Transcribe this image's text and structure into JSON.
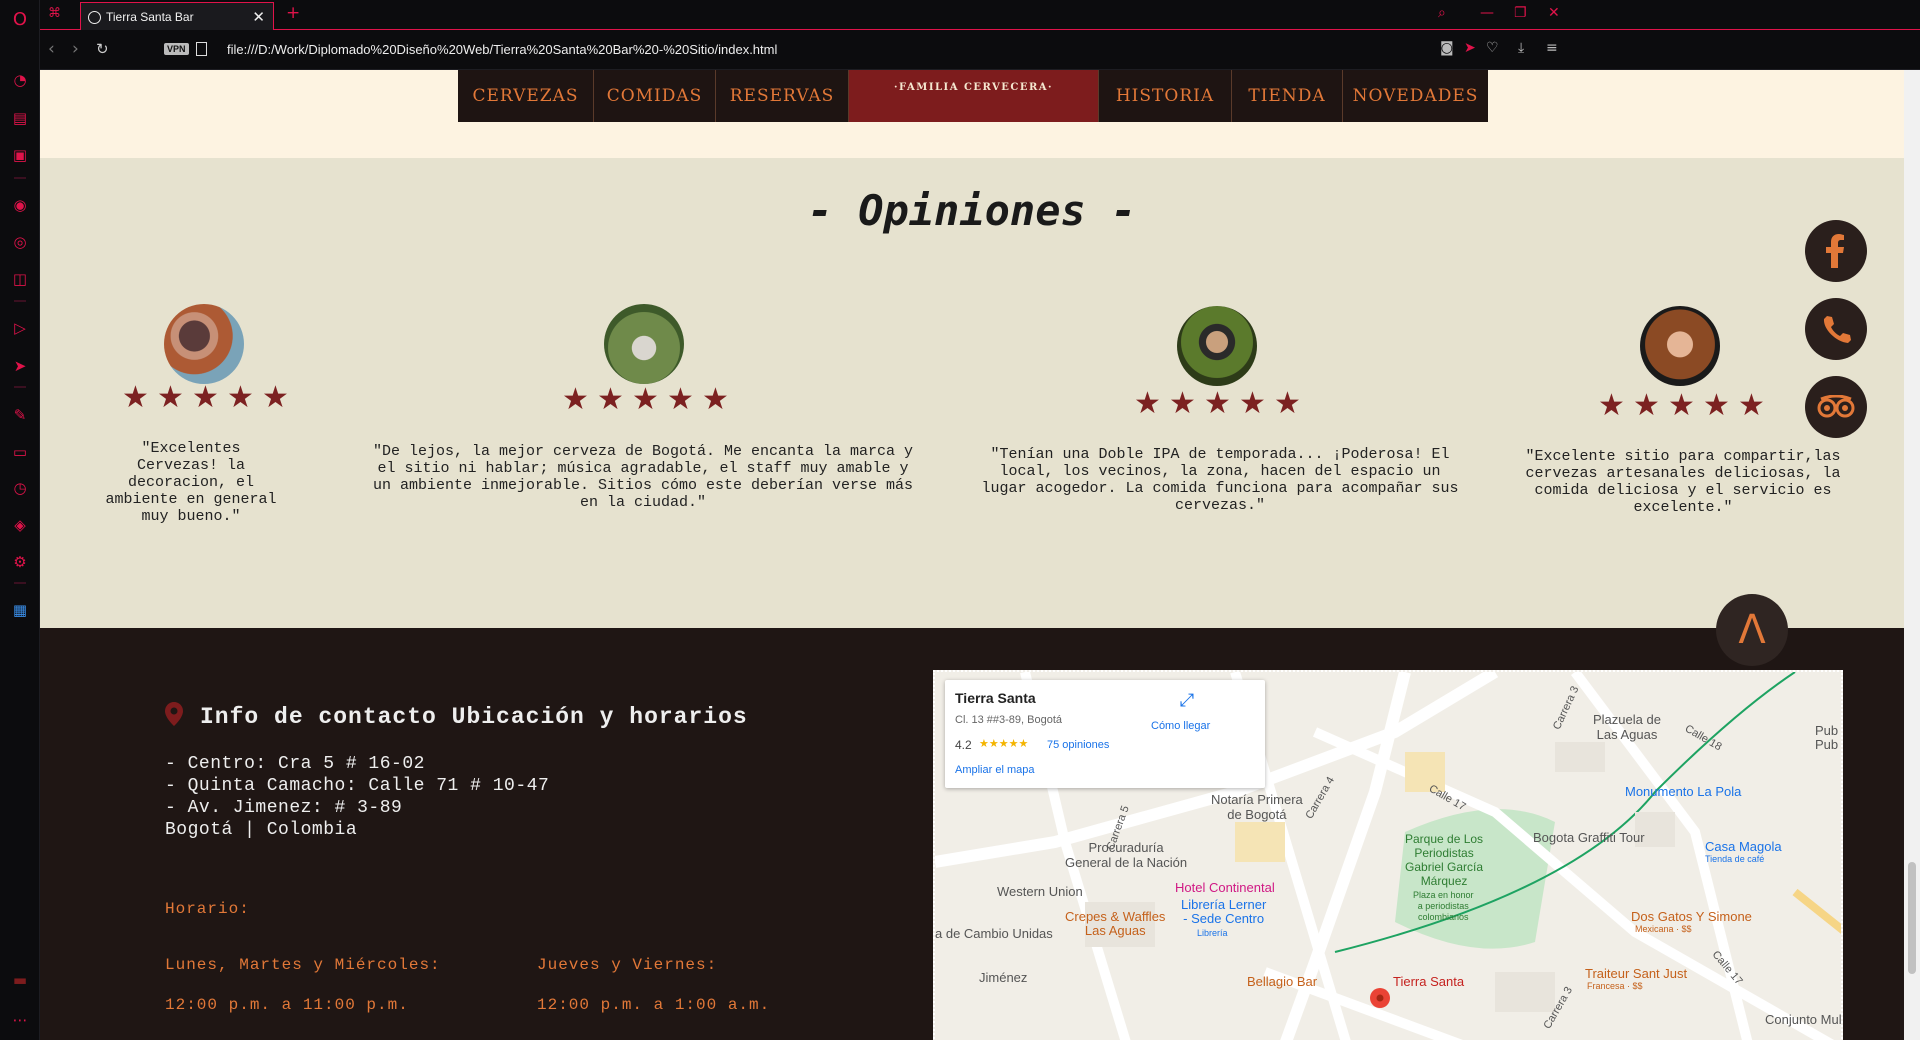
{
  "browser": {
    "tab_title": "Tierra Santa Bar",
    "url": "file:///D:/Work/Diplomado%20Diseño%20Web/Tierra%20Santa%20Bar%20-%20Sitio/index.html",
    "vpn_label": "VPN",
    "accent": "#e0134a"
  },
  "nav": {
    "items_left": [
      "CERVEZAS",
      "COMIDAS",
      "RESERVAS"
    ],
    "logo_text": "·FAMILIA CERVECERA·",
    "items_right": [
      "HISTORIA",
      "TIENDA",
      "NOVEDADES"
    ]
  },
  "opinions": {
    "title": "- Opiniones -",
    "reviews": [
      {
        "rating": 5,
        "quote": "\"Excelentes Cervezas! la decoracion, el ambiente en general muy bueno.\""
      },
      {
        "rating": 5,
        "quote": "\"De lejos, la mejor cerveza de Bogotá. Me encanta la marca y el sitio ni hablar; música agradable, el staff muy amable y un ambiente inmejorable. Sitios cómo este deberían verse más en la ciudad.\""
      },
      {
        "rating": 5,
        "quote": "\"Tenían una Doble IPA de temporada... ¡Poderosa! El local, los vecinos, la zona, hacen del espacio un lugar acogedor. La comida funciona para acompañar sus cervezas.\""
      },
      {
        "rating": 5,
        "quote": "\"Excelente sitio para compartir,las cervezas artesanales deliciosas, la comida deliciosa y el servicio es excelente.\""
      }
    ]
  },
  "social": [
    "facebook-icon",
    "phone-icon",
    "tripadvisor-icon"
  ],
  "footer": {
    "info_title": "Info de contacto Ubicación y horarios",
    "addresses": [
      "- Centro: Cra 5 # 16-02",
      "- Quinta Camacho: Calle 71 # 10-47",
      "- Av. Jimenez: # 3-89",
      "Bogotá | Colombia"
    ],
    "hours_label": "Horario:",
    "schedule": [
      {
        "days": "Lunes, Martes y Miércoles:",
        "hours": "12:00 p.m. a 11:00 p.m."
      },
      {
        "days": "Jueves y Viernes:",
        "hours": "12:00 p.m. a 1:00 a.m."
      }
    ],
    "scroll_top": "Λ"
  },
  "map": {
    "place_name": "Tierra Santa",
    "place_address": "Cl. 13 ##3-89, Bogotá",
    "rating": "4.2",
    "stars": "★★★★★",
    "reviews_link": "75 opiniones",
    "directions": "Cómo llegar",
    "enlarge": "Ampliar el mapa",
    "labels": {
      "carrera5": "Carrera 5",
      "carrera4": "Carrera 4",
      "carrera3": "Carrera 3",
      "carrera3b": "Carrera 3",
      "calle17": "Calle 17",
      "calle18": "Calle 18",
      "calle17b": "Calle 17",
      "plazuela": "Plazuela de\nLas Aguas",
      "notaria": "Notaría Primera\nde Bogotá",
      "procuraduria": "Procuraduría\nGeneral de la Nación",
      "parque": "Parque de Los\nPeriodistas\nGabriel García\nMárquez",
      "parque_sub": "Plaza en honor\na periodistas\ncolombianos",
      "graffiti": "Bogota Graffiti Tour",
      "monumento": "Monumento La Pola",
      "casa_magola": "Casa Magola",
      "casa_magola_sub": "Tienda de café",
      "western": "Western Union",
      "hotel": "Hotel Continental",
      "crepes": "Crepes & Waffles\nLas Aguas",
      "libreria": "Librería Lerner\n- Sede Centro",
      "libreria_sub": "Librería",
      "cambio": "a de Cambio Unidas",
      "jimenez": "Jiménez",
      "bellagio": "Bellagio Bar",
      "tierra": "Tierra Santa",
      "dos_gatos": "Dos Gatos Y Simone",
      "dos_gatos_sub": "Mexicana · $$",
      "traiteur": "Traiteur Sant Just",
      "traiteur_sub": "Francesa · $$",
      "conjunto": "Conjunto Multifa",
      "pub": "Pub\nPub"
    }
  }
}
